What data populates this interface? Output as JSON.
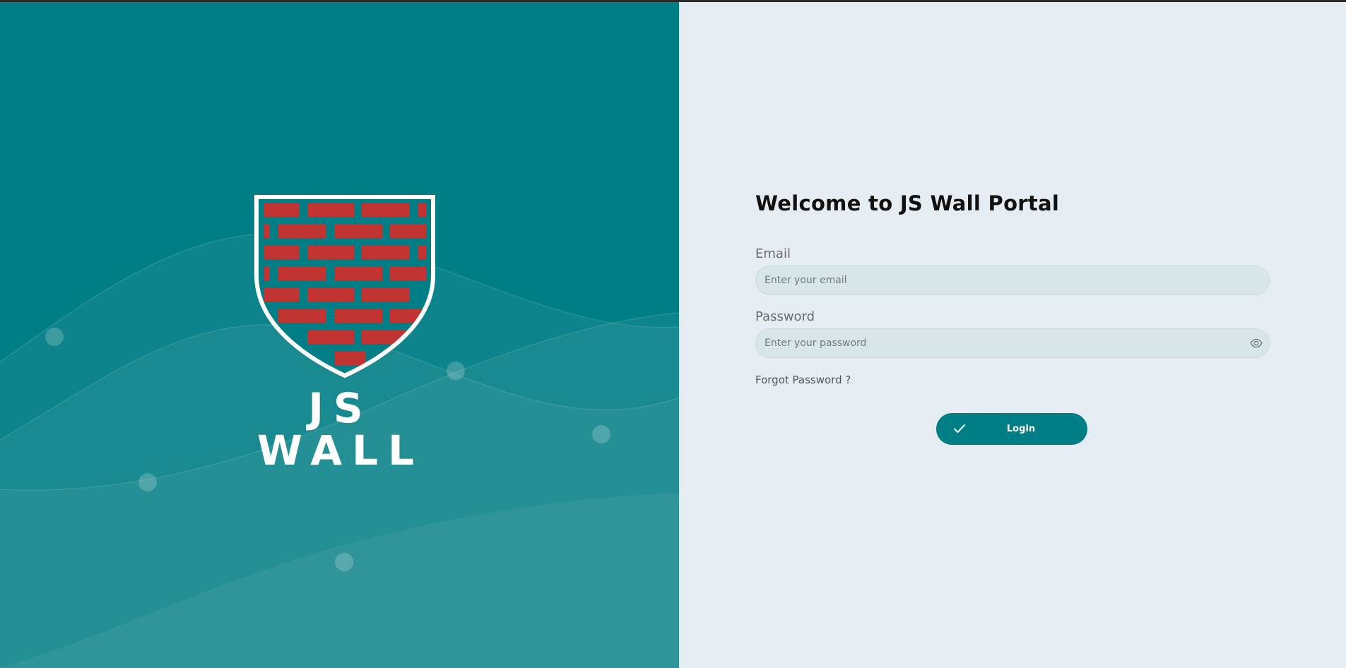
{
  "brand": {
    "logo_text": "JS WALL",
    "primary_color": "#007e85",
    "brick_color": "#c23432"
  },
  "form": {
    "title": "Welcome to JS Wall Portal",
    "email_label": "Email",
    "email_placeholder": "Enter your email",
    "email_value": "",
    "password_label": "Password",
    "password_placeholder": "Enter your password",
    "password_value": "",
    "password_toggle_icon": "eye-icon",
    "forgot_link": "Forgot Password ?",
    "login_button": "Login",
    "login_icon": "check-icon"
  }
}
